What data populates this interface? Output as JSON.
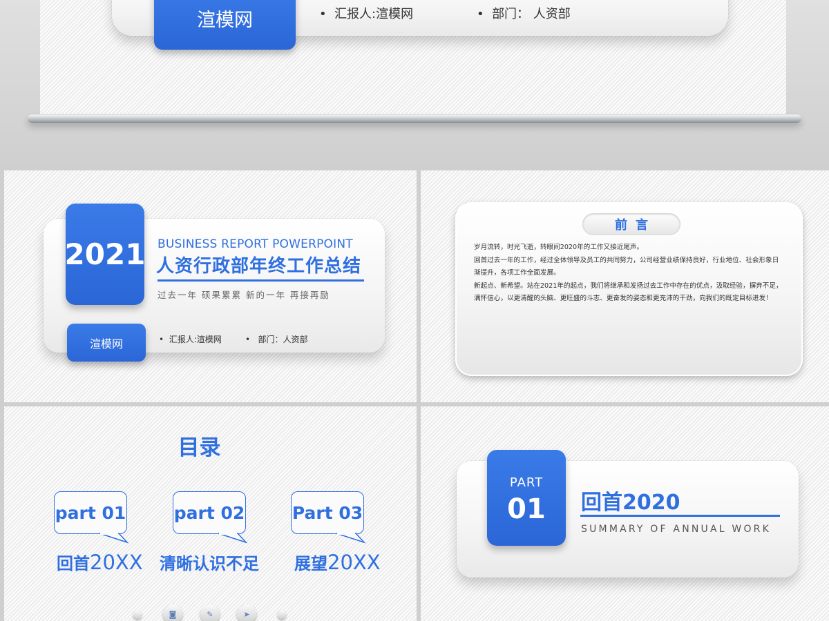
{
  "hero": {
    "button": "渲模网",
    "reporter": "汇报人:渲模网",
    "department": "部门：  人资部"
  },
  "slide1": {
    "year": "2021",
    "subtitle_en": "BUSINESS REPORT POWERPOINT",
    "title_cn": "人资行政部年终工作总结",
    "motto": "过去一年  硕果累累    新的一年  再接再励",
    "button": "渲模网",
    "reporter": "汇报人:渲模网",
    "department": "部门：人资部"
  },
  "slide2": {
    "title": "前言",
    "paragraphs": [
      "岁月流转，时光飞逝，转眼间2020年的工作又接近尾声。",
      "回首过去一年的工作，经过全体领导及员工的共同努力，公司经营业绩保持良好，行业地位、社会形象日渐提升，各项工作全面发展。",
      "新起点、新希望。站在2021年的起点，我们将继承和发扬过去工作中存在的优点，汲取经验，摒弃不足，满怀信心，以更清醒的头脑、更旺盛的斗志、更奋发的姿态和更充沛的干劲，向我们的既定目标进发！"
    ]
  },
  "slide3": {
    "title": "目录",
    "items": [
      {
        "bubble": "part 01",
        "label_cn": "回首",
        "label_num": "20XX"
      },
      {
        "bubble": "part 02",
        "label_cn": "清晰认识不足",
        "label_num": ""
      },
      {
        "bubble": "Part 03",
        "label_cn": "展望",
        "label_num": "20XX"
      }
    ],
    "nav_icons": [
      "dot",
      "camera-icon",
      "wrench-icon",
      "send-icon",
      "dot"
    ]
  },
  "slide4": {
    "part_label": "PART",
    "part_number": "01",
    "heading": "回首2020",
    "subheading": "SUMMARY OF ANNUAL WORK"
  },
  "colors": {
    "accent": "#2f6fe0",
    "background": "#f1f1f1"
  }
}
